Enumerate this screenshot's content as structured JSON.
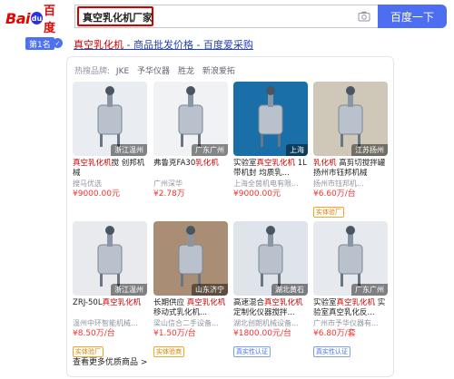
{
  "logo": {
    "latin": "Bai",
    "paw": "du",
    "cn": "百度"
  },
  "search": {
    "query": "真空乳化机厂家",
    "button": "百度一下"
  },
  "result": {
    "rank": "第1名",
    "title_kw": "真空乳化机",
    "title_rest": " - 商品批发价格 - 百度爱采购"
  },
  "hot_words": {
    "label": "热搜品牌:",
    "items": [
      "JKE",
      "予华仪器",
      "胜龙",
      "新浪爱拓"
    ]
  },
  "products": [
    {
      "kw": "真空乳化机",
      "name_rest": "搅 创邦机械",
      "shop": "搜马优选",
      "price": "¥9000.00元",
      "location": "浙江温州",
      "badge": "",
      "img_color": "#e9edf1"
    },
    {
      "kw": "",
      "name_rest": "弗鲁克FA30",
      "kw2": "乳化机",
      "shop": "广州深华",
      "price": "¥2.78万",
      "location": "广东广州",
      "badge": "",
      "img_color": "#f1f2f4"
    },
    {
      "kw": "",
      "name_rest": "实验室",
      "kw2": "真空乳化机",
      "name_tail": " 1L带机封 均质乳...",
      "shop": "上海全茵机电有限...",
      "price": "¥9000.00元",
      "location": "上海",
      "badge": "",
      "img_color": "#1a6fa8"
    },
    {
      "kw": "乳化机",
      "name_rest": " 高剪切搅拌罐 扬州市钰邦机械",
      "shop": "扬州市钰邦机...",
      "price": "¥6.60万/台",
      "location": "江苏扬州",
      "badge": "实体验厂",
      "img_color": "#cfc8b8"
    },
    {
      "kw": "",
      "name_rest": "ZRJ-50L",
      "kw2": "真空乳化机",
      "shop": "温州中环智能机械...",
      "price": "¥8.50万/台",
      "location": "浙江温州",
      "badge": "实体验厂",
      "img_color": "#e8eaed"
    },
    {
      "kw": "",
      "name_rest": "长期供应 ",
      "kw2": "真空乳化机",
      "name_tail": " 移动式乳化机...",
      "shop": "梁山信合二手设备...",
      "price": "¥1.50万/台",
      "location": "山东济宁",
      "badge": "实体验商",
      "img_color": "#a98d74"
    },
    {
      "kw": "",
      "name_rest": "高速混合",
      "kw2": "真空乳化机",
      "name_tail": " 定制化仪器搅拌...",
      "shop": "湖北创朗机械设备...",
      "price": "¥1800.00元/台",
      "location": "湖北黄石",
      "badge": "真实性认证",
      "badge_blue": true,
      "img_color": "#dfe3ea"
    },
    {
      "kw": "",
      "name_rest": "实验室",
      "kw2": "真空乳化机",
      "name_tail": " 实验室真空乳化反...",
      "shop": "广州市予华仪器有...",
      "price": "¥6.80万/套",
      "location": "广东广州",
      "badge": "真实性认证",
      "badge_blue": true,
      "img_color": "#e6e9ee"
    }
  ],
  "more_link": "查看更多优质商品 >"
}
